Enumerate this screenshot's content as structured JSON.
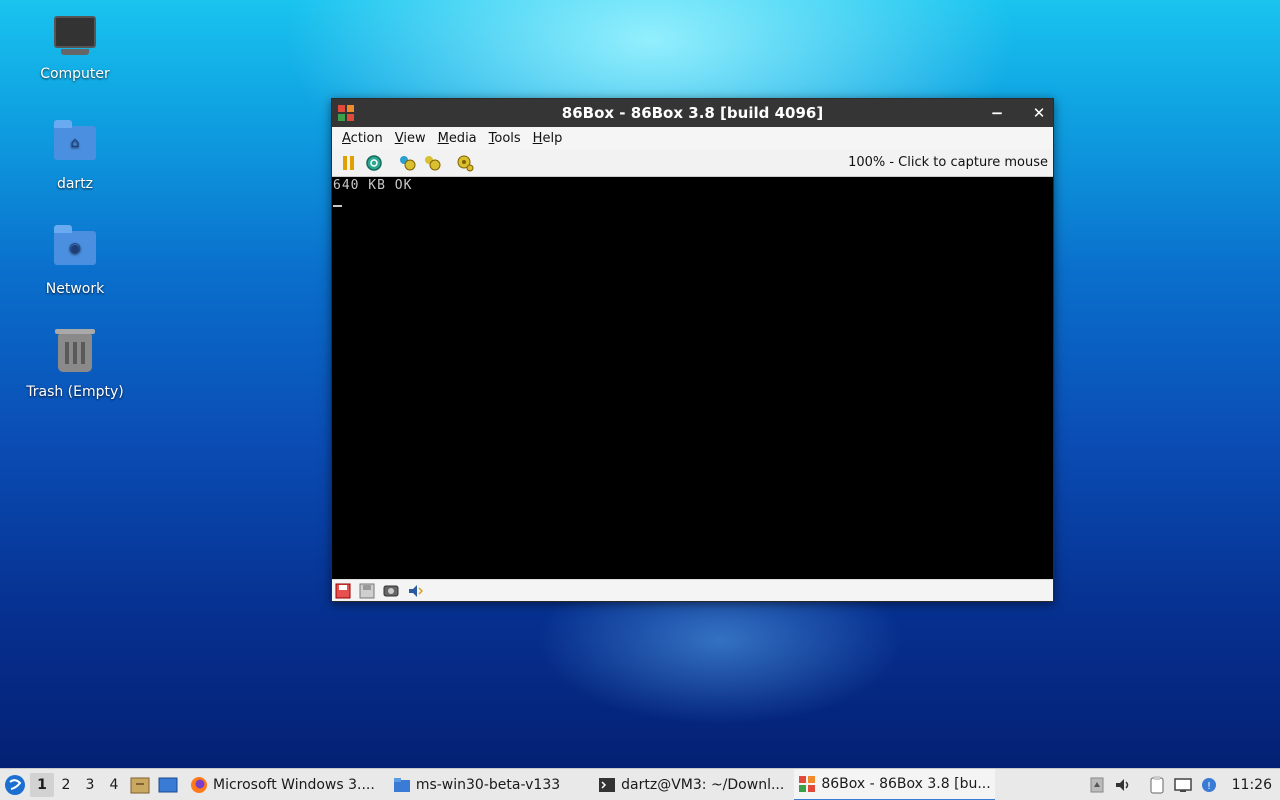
{
  "desktop": {
    "icons": [
      {
        "label": "Computer"
      },
      {
        "label": "dartz"
      },
      {
        "label": "Network"
      },
      {
        "label": "Trash (Empty)"
      }
    ]
  },
  "window": {
    "title": "86Box - 86Box 3.8 [build 4096]",
    "minimize_glyph": "−",
    "close_glyph": "✕",
    "menu": [
      "Action",
      "View",
      "Media",
      "Tools",
      "Help"
    ],
    "status_text": "100% - Click to capture mouse",
    "screen": {
      "line1": "640 KB OK"
    }
  },
  "taskbar": {
    "workspaces": [
      "1",
      "2",
      "3",
      "4"
    ],
    "tasks": [
      {
        "label": "Microsoft Windows 3...."
      },
      {
        "label": "ms-win30-beta-v133"
      },
      {
        "label": "dartz@VM3: ~/Downl..."
      },
      {
        "label": "86Box - 86Box 3.8 [bu..."
      }
    ],
    "clock": "11:26"
  }
}
